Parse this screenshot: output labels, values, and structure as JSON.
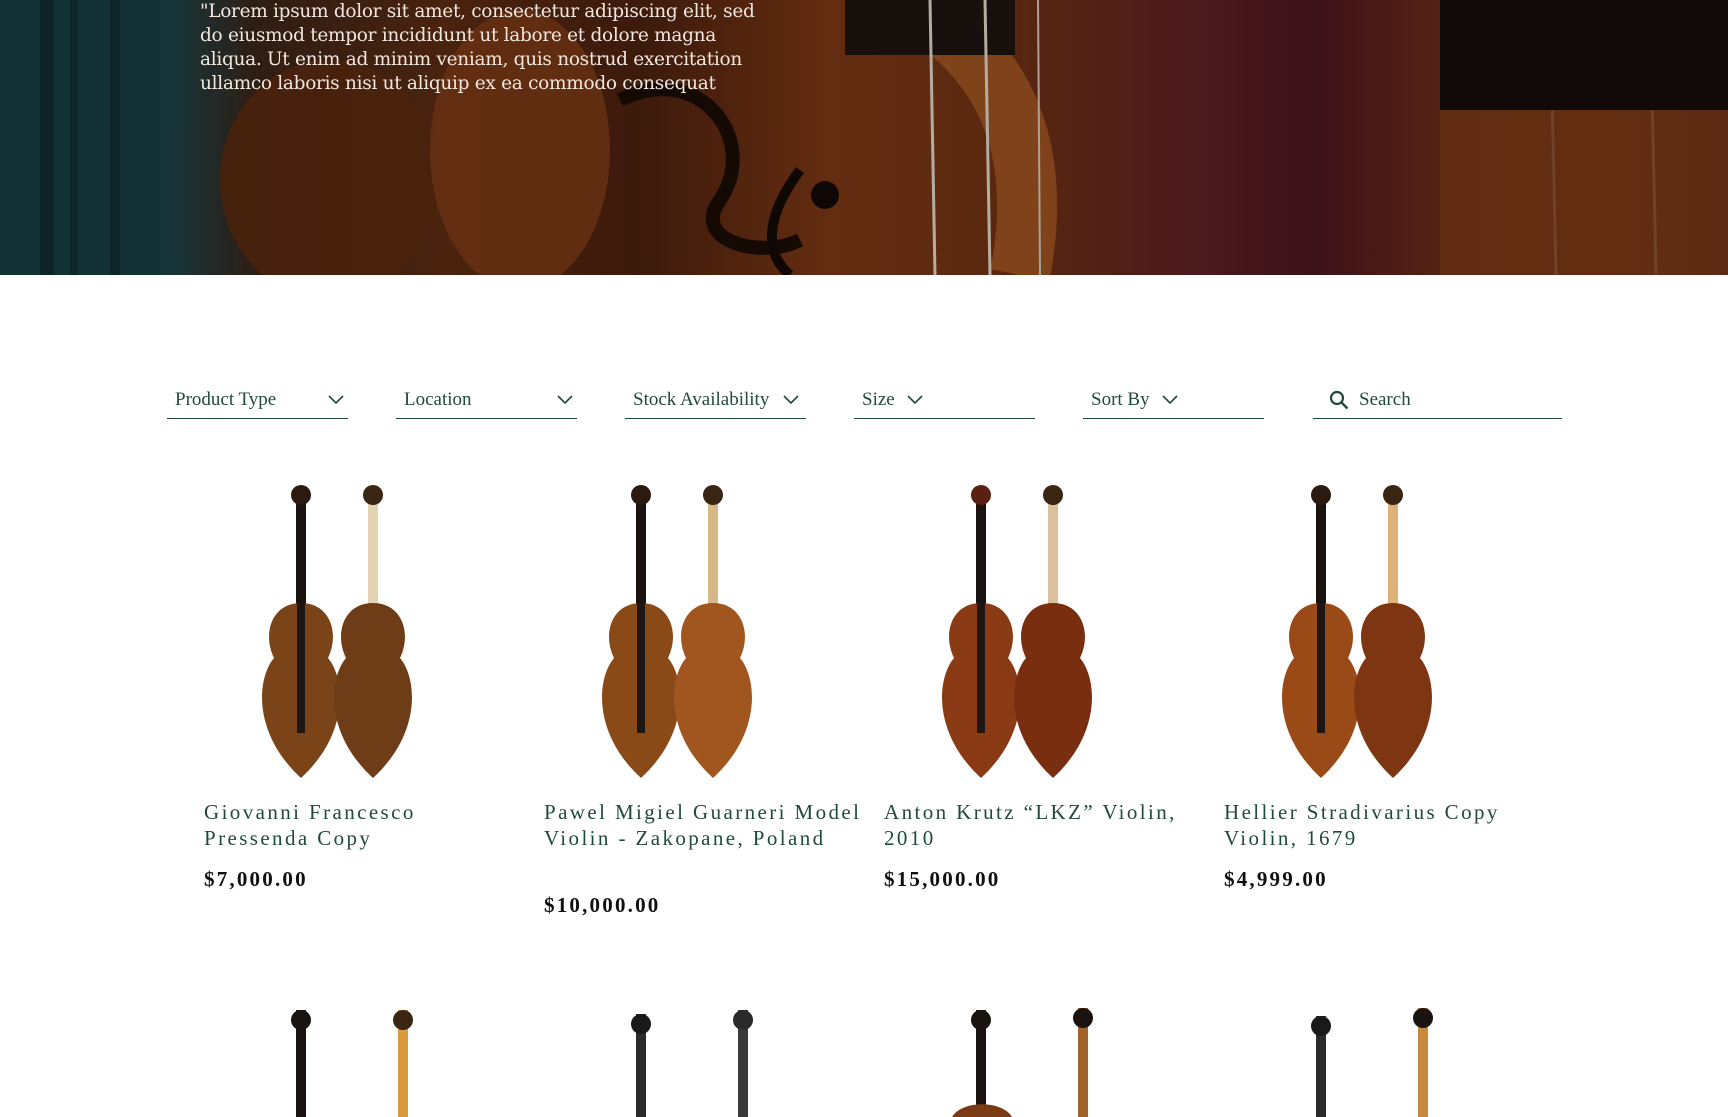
{
  "hero": {
    "quote": "\"Lorem ipsum dolor sit amet, consectetur adipiscing elit, sed do eiusmod tempor incididunt ut labore et dolore magna aliqua. Ut enim ad minim veniam, quis nostrud exercitation ullamco laboris nisi ut aliquip ex ea commodo consequat"
  },
  "filters": {
    "product_type": "Product Type",
    "location": "Location",
    "stock": "Stock Availability",
    "size": "Size",
    "sort": "Sort By",
    "search_placeholder": "Search"
  },
  "icons": {
    "chevron": "chevron-down-icon",
    "search": "search-icon"
  },
  "colors": {
    "accent": "#1f4a3c",
    "price": "#101010"
  },
  "products": [
    {
      "name": "Giovanni Francesco Pressenda Copy",
      "price": "$7,000.00"
    },
    {
      "name": "Pawel Migiel Guarneri Model Violin - Zakopane, Poland",
      "price": "$10,000.00"
    },
    {
      "name": "Anton Krutz “LKZ” Violin, 2010",
      "price": "$15,000.00"
    },
    {
      "name": "Hellier Stradivarius Copy Violin, 1679",
      "price": "$4,999.00"
    }
  ]
}
